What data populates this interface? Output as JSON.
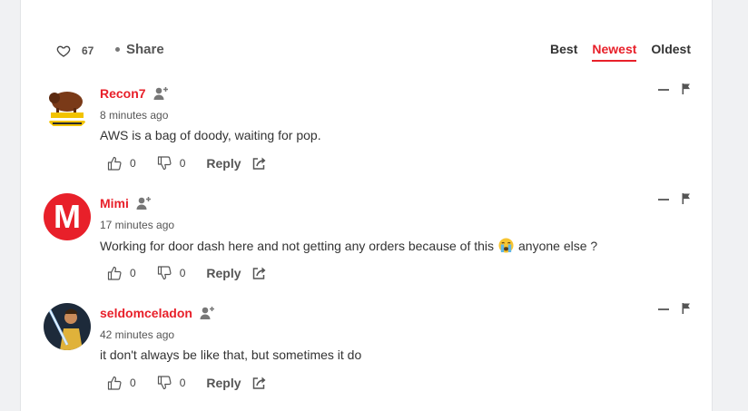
{
  "toolbar": {
    "like_count": "67",
    "share_label": "Share",
    "sort_tabs": [
      "Best",
      "Newest",
      "Oldest"
    ],
    "active_tab": "Newest"
  },
  "accent_color": "#e8202a",
  "comments": [
    {
      "username": "Recon7",
      "time": "8 minutes ago",
      "text": "AWS is a bag of doody, waiting for pop.",
      "likes": "0",
      "dislikes": "0",
      "reply_label": "Reply",
      "avatar_icon": "buffalo-crest-icon"
    },
    {
      "username": "Mimi",
      "time": "17 minutes ago",
      "text_before": "Working for door dash here and not getting any orders because of this",
      "text_after": "anyone else ?",
      "emoji_icon": "crying-face-emoji",
      "likes": "0",
      "dislikes": "0",
      "reply_label": "Reply",
      "avatar_letter": "M"
    },
    {
      "username": "seldomceladon",
      "time": "42 minutes ago",
      "text": "it don't always be like that, but sometimes it do",
      "likes": "0",
      "dislikes": "0",
      "reply_label": "Reply",
      "avatar_icon": "lightsaber-character-icon"
    }
  ]
}
